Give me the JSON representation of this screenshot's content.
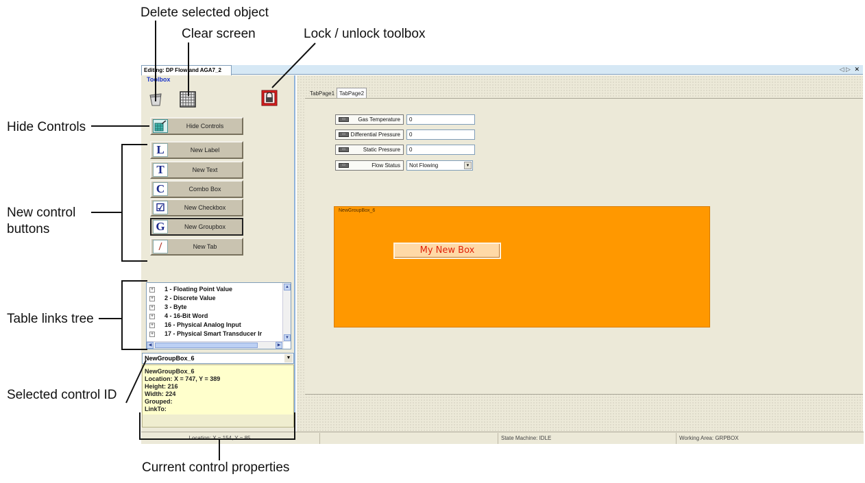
{
  "callouts": {
    "delete_selected": "Delete selected object",
    "clear_screen": "Clear screen",
    "lock_toolbox": "Lock / unlock toolbox",
    "hide_controls": "Hide Controls",
    "new_control_line1": "New control",
    "new_control_line2": "buttons",
    "table_links": "Table links tree",
    "selected_control": "Selected control ID",
    "current_props": "Current control properties"
  },
  "window": {
    "editor_tab": "Editing: DP Flow and AGA7_2",
    "toolbox_title": "Toolbox",
    "controls": [
      "◁ ▷",
      "✕"
    ]
  },
  "toolbox": {
    "icons": [
      "trash-icon",
      "grid-icon",
      "lock-icon"
    ],
    "hide_controls": "Hide Controls",
    "buttons": [
      {
        "glyph": "L",
        "label": "New Label"
      },
      {
        "glyph": "T",
        "label": "New Text"
      },
      {
        "glyph": "C",
        "label": "Combo Box"
      },
      {
        "glyph": "☑",
        "label": "New Checkbox"
      },
      {
        "glyph": "G",
        "label": "New Groupbox"
      },
      {
        "glyph": "/",
        "label": "New Tab"
      }
    ],
    "tree": [
      "1 - Floating Point Value",
      "2 - Discrete Value",
      "3 - Byte",
      "4 - 16-Bit Word",
      "16 - Physical Analog Input",
      "17 - Physical Smart Transducer Ir"
    ],
    "selected_control": "NewGroupBox_6",
    "properties": [
      "NewGroupBox_6",
      "Location: X = 747, Y = 389",
      "Height: 216",
      "Width: 224",
      "Grouped:",
      "LinkTo:"
    ]
  },
  "design": {
    "tabs": [
      "TabPage1",
      "TabPage2"
    ],
    "active_tab": "TabPage2",
    "fields": [
      {
        "label": "Gas Temperature",
        "value": "0"
      },
      {
        "label": "Differential Pressure",
        "value": "0"
      },
      {
        "label": "Static Pressure",
        "value": "0"
      }
    ],
    "flow_status": {
      "label": "Flow Status",
      "value": "Not Flowing"
    },
    "groupbox_title": "NewGroupBox_6",
    "my_new_box": "My New Box",
    "groupbox_color": "#ff9800"
  },
  "statusbar": {
    "location": "Location: X = 154, Y = 85",
    "state_machine": "State Machine: IDLE",
    "working_area": "Working Area: GRPBOX"
  }
}
